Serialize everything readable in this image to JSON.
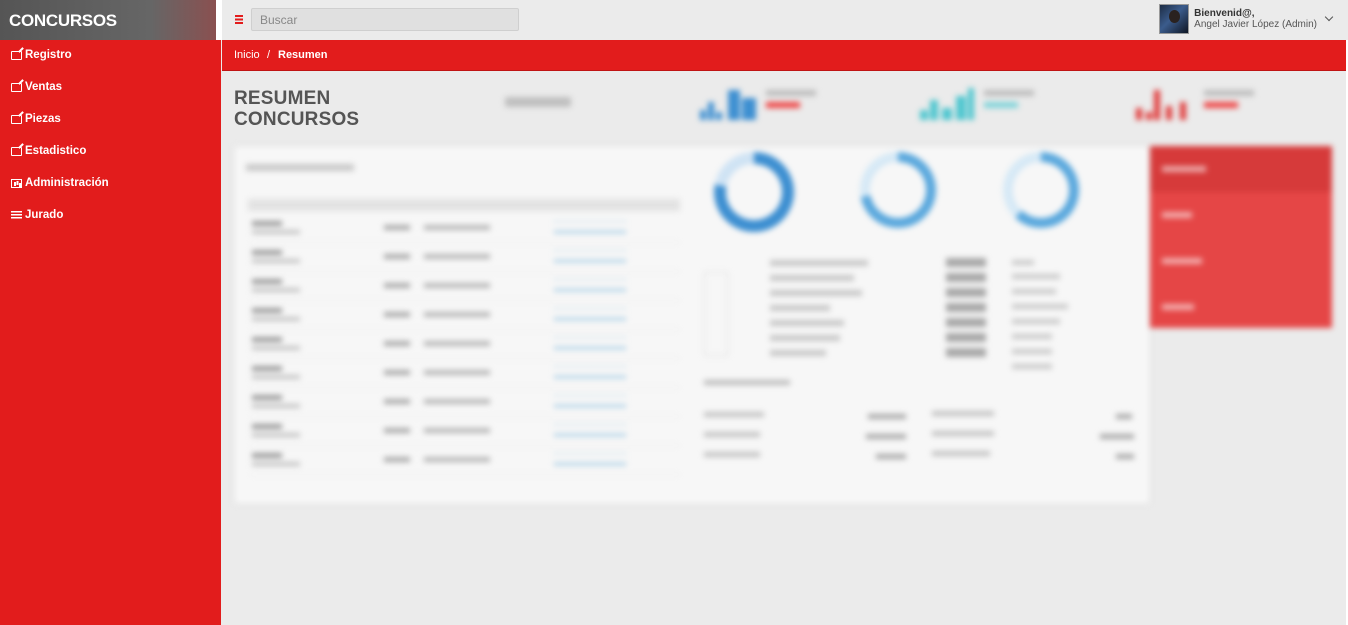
{
  "app": {
    "brand": "CONCURSOS"
  },
  "sidebar": {
    "items": [
      {
        "label": "Registro",
        "icon": "edit-icon"
      },
      {
        "label": "Ventas",
        "icon": "edit-icon"
      },
      {
        "label": "Piezas",
        "icon": "edit-icon"
      },
      {
        "label": "Estadistico",
        "icon": "edit-icon"
      },
      {
        "label": "Administración",
        "icon": "bar-chart-icon"
      },
      {
        "label": "Jurado",
        "icon": "list-icon"
      }
    ]
  },
  "topbar": {
    "search_placeholder": "Buscar",
    "user_greeting": "Bienvenid@,",
    "user_name": "Angel Javier López (Admin)"
  },
  "breadcrumb": {
    "items": [
      "Inicio",
      "Resumen"
    ],
    "separator": "/"
  },
  "page": {
    "title_line1": "RESUMEN",
    "title_line2": "CONCURSOS"
  },
  "colors": {
    "accent": "#e21c1c",
    "brand_bg": "#5f5f5f",
    "page_bg": "#ebebeb",
    "spark_blue": "#3d8fd1",
    "spark_teal": "#4fc6cf",
    "spark_red": "#e03a3a"
  }
}
